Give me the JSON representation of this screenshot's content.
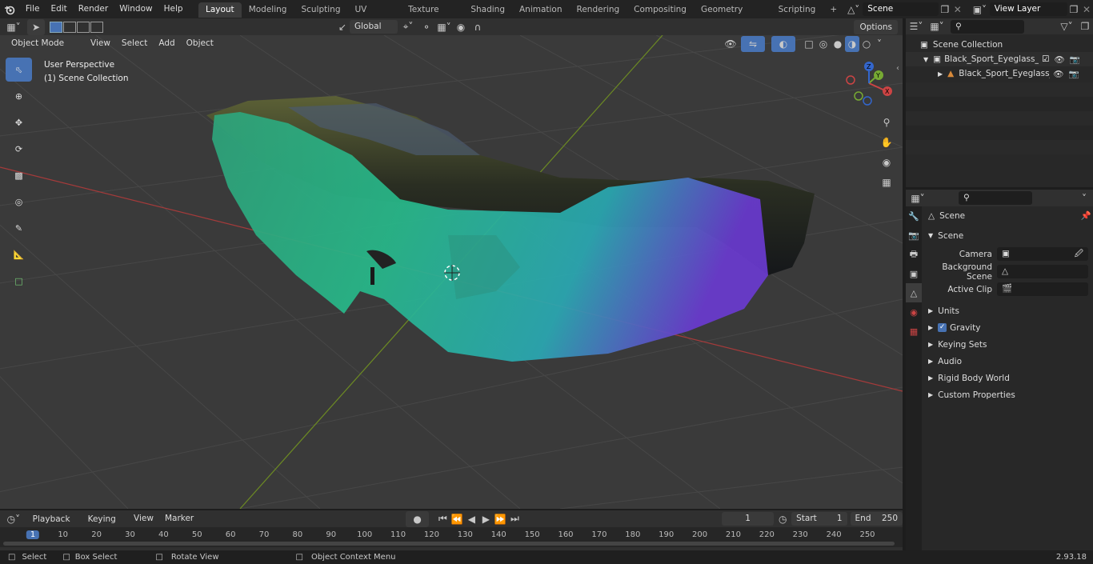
{
  "menus": [
    "File",
    "Edit",
    "Render",
    "Window",
    "Help"
  ],
  "workspaces": [
    "Layout",
    "Modeling",
    "Sculpting",
    "UV Editing",
    "Texture Paint",
    "Shading",
    "Animation",
    "Rendering",
    "Compositing",
    "Geometry Nodes",
    "Scripting"
  ],
  "scene_name": "Scene",
  "view_layer": "View Layer",
  "viewport": {
    "mode": "Object Mode",
    "menu": [
      "View",
      "Select",
      "Add",
      "Object"
    ],
    "orientation": "Global",
    "options": "Options",
    "perspective": "User Perspective",
    "collection": "(1) Scene Collection"
  },
  "outliner": {
    "root": "Scene Collection",
    "items": [
      {
        "label": "Black_Sport_Eyeglass_Green_"
      },
      {
        "label": "Black_Sport_Eyeglass_Gr"
      }
    ]
  },
  "properties": {
    "header": "Scene",
    "section": "Scene",
    "fields": [
      {
        "label": "Camera"
      },
      {
        "label": "Background Scene"
      },
      {
        "label": "Active Clip"
      }
    ],
    "panels": [
      "Units",
      "Gravity",
      "Keying Sets",
      "Audio",
      "Rigid Body World",
      "Custom Properties"
    ]
  },
  "timeline": {
    "menus": [
      "Playback",
      "Keying",
      "View",
      "Marker"
    ],
    "current_frame": "1",
    "start_label": "Start",
    "start": "1",
    "end_label": "End",
    "end": "250",
    "ticks": [
      "1",
      "10",
      "20",
      "30",
      "40",
      "50",
      "60",
      "70",
      "80",
      "90",
      "100",
      "110",
      "120",
      "130",
      "140",
      "150",
      "160",
      "170",
      "180",
      "190",
      "200",
      "210",
      "220",
      "230",
      "240",
      "250"
    ]
  },
  "status": {
    "select": "Select",
    "box_select": "Box Select",
    "rotate": "Rotate View",
    "context": "Object Context Menu",
    "version": "2.93.18"
  },
  "colors": {
    "accent": "#4772b3",
    "x_axis": "#c44",
    "y_axis": "#7a9a2a"
  }
}
